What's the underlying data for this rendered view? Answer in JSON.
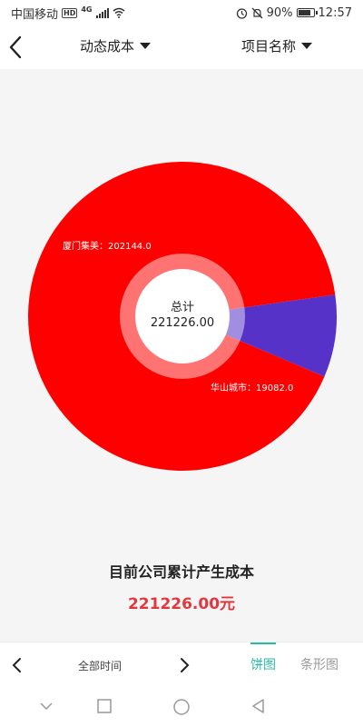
{
  "status_bar": {
    "carrier": "中国移动",
    "hd": "HD",
    "network": "4G",
    "battery_text": "90%",
    "battery_level": 0.9,
    "time": "12:57"
  },
  "header": {
    "dropdown_cost": "动态成本",
    "dropdown_project": "项目名称"
  },
  "chart_data": {
    "type": "pie",
    "style": "donut",
    "center_title": "总计",
    "center_value": "221226.00",
    "slices": [
      {
        "name": "厦门集美",
        "value": 202144.0,
        "label": "厦门集美：202144.0",
        "color": "#ff0000"
      },
      {
        "name": "华山城市",
        "value": 19082.0,
        "label": "华山城市：19082.0",
        "color": "#5632c8"
      }
    ]
  },
  "summary": {
    "title": "目前公司累计产生成本",
    "value": "221226.00元",
    "value_color": "#e0383e"
  },
  "toolbar": {
    "time_range": "全部时间",
    "tab_pie": "饼图",
    "tab_bar": "条形图",
    "accent": "#28b9a5"
  },
  "icons": {
    "back": "back-arrow-icon",
    "prev": "chevron-left-icon",
    "next": "chevron-right-icon",
    "dropdown": "caret-down-icon"
  }
}
